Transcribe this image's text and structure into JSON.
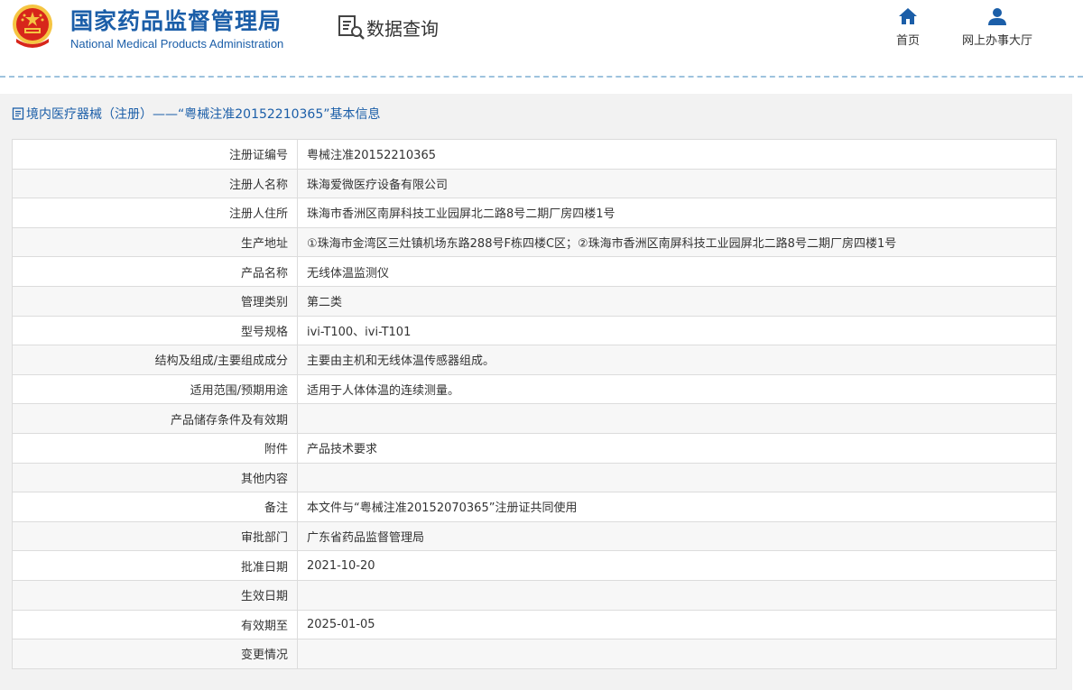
{
  "header": {
    "title_cn": "国家药品监督管理局",
    "title_en": "National Medical Products Administration",
    "data_query": "数据查询",
    "nav": {
      "home": "首页",
      "online_service": "网上办事大厅"
    }
  },
  "panel": {
    "title": "境内医疗器械（注册）——“粤械注准20152210365”基本信息"
  },
  "rows": [
    {
      "label": "注册证编号",
      "value": "粤械注准20152210365"
    },
    {
      "label": "注册人名称",
      "value": "珠海爱微医疗设备有限公司"
    },
    {
      "label": "注册人住所",
      "value": "珠海市香洲区南屏科技工业园屏北二路8号二期厂房四楼1号"
    },
    {
      "label": "生产地址",
      "value": "①珠海市金湾区三灶镇机场东路288号F栋四楼C区；②珠海市香洲区南屏科技工业园屏北二路8号二期厂房四楼1号"
    },
    {
      "label": "产品名称",
      "value": "无线体温监测仪"
    },
    {
      "label": "管理类别",
      "value": "第二类"
    },
    {
      "label": "型号规格",
      "value": "ivi-T100、ivi-T101"
    },
    {
      "label": "结构及组成/主要组成成分",
      "value": "主要由主机和无线体温传感器组成。"
    },
    {
      "label": "适用范围/预期用途",
      "value": "适用于人体体温的连续测量。"
    },
    {
      "label": "产品储存条件及有效期",
      "value": ""
    },
    {
      "label": "附件",
      "value": "产品技术要求"
    },
    {
      "label": "其他内容",
      "value": ""
    },
    {
      "label": "备注",
      "value": "本文件与“粤械注准20152070365”注册证共同使用"
    },
    {
      "label": "审批部门",
      "value": "广东省药品监督管理局"
    },
    {
      "label": "批准日期",
      "value": "2021-10-20"
    },
    {
      "label": "生效日期",
      "value": ""
    },
    {
      "label": "有效期至",
      "value": "2025-01-05"
    },
    {
      "label": "变更情况",
      "value": ""
    }
  ],
  "colors": {
    "brand_blue": "#1b5ea8",
    "emblem_red": "#d7261b",
    "emblem_gold": "#f5c542"
  }
}
